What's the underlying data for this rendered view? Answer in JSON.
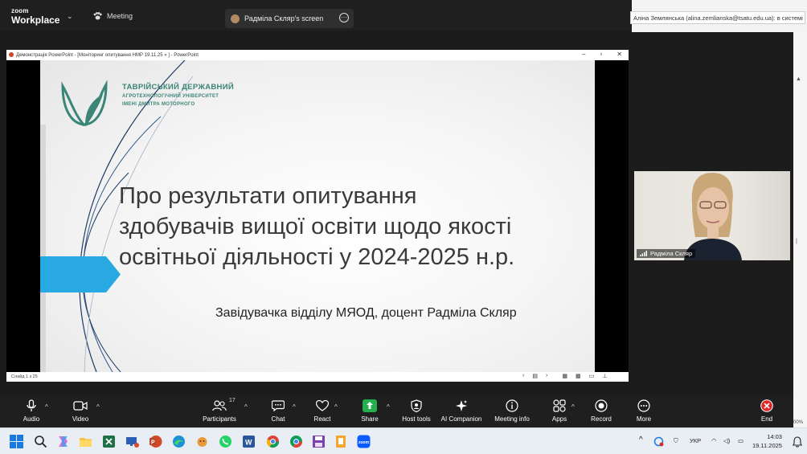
{
  "topbar": {
    "brand_top": "zoom",
    "brand_bottom": "Workplace",
    "meeting_label": "Meeting",
    "screen_tab_label": "Радміла Скляр's screen",
    "email_text": "Аліна Землянська (alina.zemlianska@tsatu.edu.ua): в системі",
    "zoom_pct": "00%"
  },
  "ppt": {
    "window_title": "Демонстрація PowerPoint - [Моніторинг опитування НМР 19.11.25 » ] - PowerPoint",
    "status_slide": "Слайд 1 з 25",
    "university_line1": "ТАВРІЙСЬКИЙ ДЕРЖАВНИЙ",
    "university_line2": "АГРОТЕХНОЛОГІЧНИЙ УНІВЕРСИТЕТ",
    "university_line3": "ІМЕНІ ДМИТРА МОТОРНОГО",
    "title_line1": "Про результати опитування",
    "title_line2": "здобувачів вищої освіти щодо якості",
    "title_line3": "освітньої діяльності у 2024-2025 н.р.",
    "subtitle": "Завідувачка відділу МЯОД, доцент  Радміла Скляр"
  },
  "video": {
    "participant_name": "Радміла Скляр"
  },
  "toolbar": {
    "audio": "Audio",
    "video": "Video",
    "participants": "Participants",
    "participants_count": "17",
    "chat": "Chat",
    "react": "React",
    "share": "Share",
    "host_tools": "Host tools",
    "ai_companion": "AI Companion",
    "meeting_info": "Meeting info",
    "apps": "Apps",
    "record": "Record",
    "more": "More",
    "end": "End"
  },
  "taskbar": {
    "language": "УКР",
    "time": "14:03",
    "date": "19.11.2025"
  },
  "colors": {
    "zoom_bg": "#1f1f1f",
    "share_green": "#22b14c",
    "brand_teal": "#3b8577",
    "slide_arrow": "#29a9e1",
    "end_red": "#e02828"
  }
}
